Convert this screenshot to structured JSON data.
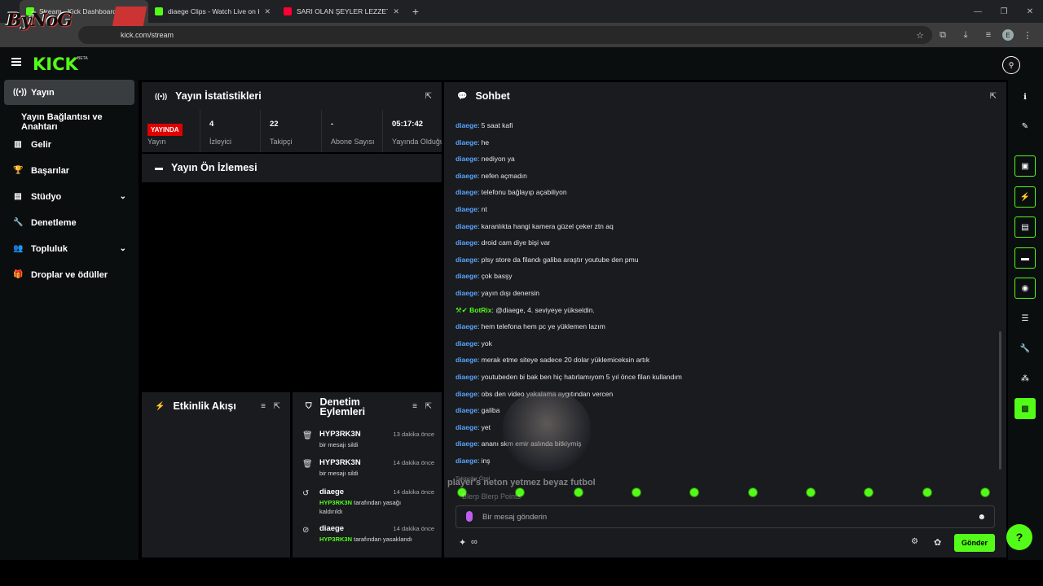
{
  "browser": {
    "tabs": [
      {
        "title": "Stream - Kick Dashboard",
        "active": true
      },
      {
        "title": "diaege Clips - Watch Live on Ki",
        "active": false
      },
      {
        "title": "SARI OLAN ŞEYLER LEZZETLİDİ",
        "active": false
      }
    ],
    "url": "kick.com/stream",
    "watermark": "ByNoG"
  },
  "app": {
    "logo": "KICK",
    "logo_tag": "BETA"
  },
  "sidebar": {
    "items": [
      {
        "label": "Yayın",
        "icon": "broadcast-icon"
      },
      {
        "label": "Yayın Bağlantısı ve Anahtarı"
      },
      {
        "label": "Gelir",
        "icon": "chart-icon"
      },
      {
        "label": "Başarılar",
        "icon": "trophy-icon"
      },
      {
        "label": "Stüdyo",
        "icon": "studio-icon"
      },
      {
        "label": "Denetleme",
        "icon": "wrench-icon"
      },
      {
        "label": "Topluluk",
        "icon": "users-icon"
      },
      {
        "label": "Droplar ve ödüller",
        "icon": "gift-icon"
      }
    ]
  },
  "stats": {
    "title": "Yayın İstatistikleri",
    "badge": "YAYINDA",
    "cells": [
      {
        "value": "",
        "label": "Yayın"
      },
      {
        "value": "4",
        "label": "İzleyici"
      },
      {
        "value": "22",
        "label": "Takipçi"
      },
      {
        "value": "-",
        "label": "Abone Sayısı"
      },
      {
        "value": "05:17:42",
        "label": "Yayında Olduğu"
      }
    ]
  },
  "preview": {
    "title": "Yayın Ön İzlemesi"
  },
  "activity": {
    "title": "Etkinlik Akışı"
  },
  "moderation": {
    "title": "Denetim Eylemleri",
    "rows": [
      {
        "user": "HYP3RK3N",
        "time": "13 dakika önce",
        "desc": "bir mesajı sildi",
        "icon": "trash-icon"
      },
      {
        "user": "HYP3RK3N",
        "time": "14 dakika önce",
        "desc": "bir mesajı sildi",
        "icon": "trash-icon"
      },
      {
        "user": "diaege",
        "time": "14 dakika önce",
        "actor": "HYP3RK3N",
        "desc": "tarafından yasağı kaldırıldı",
        "icon": "undo-icon"
      },
      {
        "user": "diaege",
        "time": "14 dakika önce",
        "actor": "HYP3RK3N",
        "desc": "tarafından yasaklandı",
        "icon": "ban-icon"
      }
    ]
  },
  "chat": {
    "title": "Sohbet",
    "messages": [
      {
        "user": "diaege",
        "text": ": 5 saat kafi"
      },
      {
        "user": "diaege",
        "text": ": he"
      },
      {
        "user": "diaege",
        "text": ": nediyon ya"
      },
      {
        "user": "diaege",
        "text": ": nefen açmadın"
      },
      {
        "user": "diaege",
        "text": ": telefonu bağlayıp açabiliyon"
      },
      {
        "user": "diaege",
        "text": ": nt"
      },
      {
        "user": "diaege",
        "text": ": karanlıkta hangi kamera güzel çeker ztn aq"
      },
      {
        "user": "diaege",
        "text": ": droid cam diye bişi var"
      },
      {
        "user": "diaege",
        "text": ": plsy store da filandı galiba araştır youtube den pmu"
      },
      {
        "user": "diaege",
        "text": ": çok basşy"
      },
      {
        "user": "diaege",
        "text": ": yayın dışı denersin"
      },
      {
        "user": "BotRix",
        "text": ": @diaege, 4. seviyeye yükseldin.",
        "bot": true
      },
      {
        "user": "diaege",
        "text": ": hem telefona hem pc ye yüklemen lazım"
      },
      {
        "user": "diaege",
        "text": ": yok"
      },
      {
        "user": "diaege",
        "text": ": merak etme siteye sadece 20 dolar yüklemiceksin artık"
      },
      {
        "user": "diaege",
        "text": ": youtubeden bi bak ben hiç hatırlamıyom 5 yıl önce filan kullandım"
      },
      {
        "user": "diaege",
        "text": ": obs den video yakalama aygıtından vercen"
      },
      {
        "user": "diaege",
        "text": ": galiba"
      },
      {
        "user": "diaege",
        "text": ": yet"
      },
      {
        "user": "diaege",
        "text": ": ananı skm emir aslında bitkiymiş"
      },
      {
        "user": "diaege",
        "text": ": inş"
      }
    ],
    "overlay_text": "player's neton yetmez beyaz futbol",
    "overlay_sub": "Takipçiler Özel",
    "overlay_sub2": "Blerp Blerp Points",
    "input_placeholder": "Bir mesaj gönderin",
    "send_label": "Gönder",
    "infinity": "∞"
  },
  "colors": {
    "accent": "#53fc18",
    "live": "#e00000",
    "username": "#58a6ff",
    "panel": "#191b1f"
  }
}
